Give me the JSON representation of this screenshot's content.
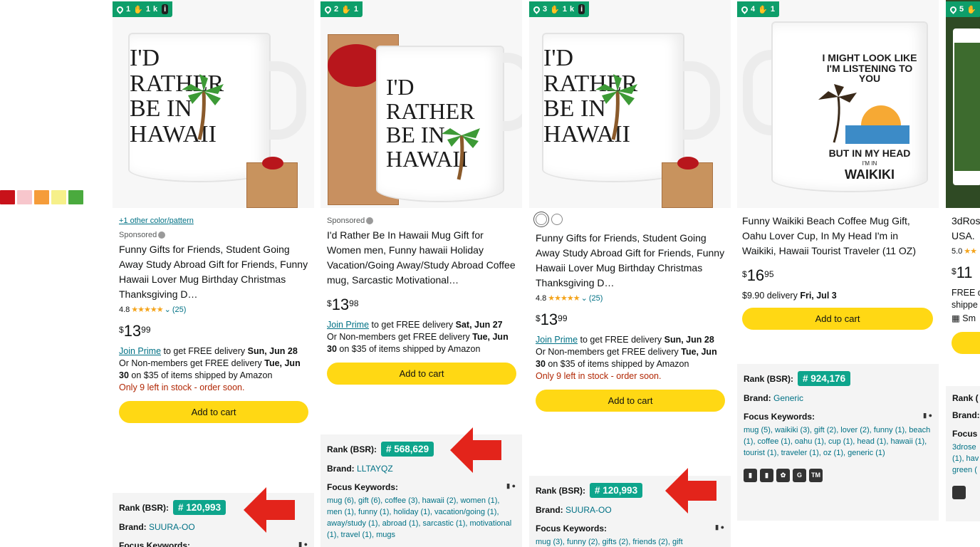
{
  "swatches": [
    "#c8121a",
    "#f7c6cc",
    "#f59c3a",
    "#f6f08a",
    "#4aaa3e"
  ],
  "cards": [
    {
      "label_num": "1",
      "label_reviews": "1",
      "label_extra": "k",
      "img_text": "I'D RATHER BE IN HAWAII",
      "other_color_link": "+1 other color/pattern",
      "sponsored": "Sponsored",
      "title": "Funny Gifts for Friends, Student Going Away Study Abroad Gift for Friends, Funny Hawaii Lover Mug Birthday Christmas Thanksgiving D…",
      "rating": "4.8",
      "stars": "★★★★★",
      "reviews": "(25)",
      "price_cur": "$",
      "price_whole": "13",
      "price_frac": "99",
      "join_prime": "Join Prime",
      "delivery_prime": " to get FREE delivery ",
      "delivery_prime_date": "Sun, Jun 28",
      "delivery_or": "Or Non-members get FREE delivery ",
      "delivery_or_date": "Tue, Jun 30",
      "delivery_or_tail": " on $35 of items shipped by Amazon",
      "stock": "Only 9 left in stock - order soon.",
      "cart": "Add to cart",
      "rank_label": "Rank (BSR):",
      "rank": "# 120,993",
      "brand_label": "Brand:",
      "brand": "SUURA-OO",
      "focus_label": "Focus Keywords:"
    },
    {
      "label_num": "2",
      "label_reviews": "1",
      "img_text": "I'D RATHER BE IN HAWAII",
      "sponsored": "Sponsored",
      "title": "I'd Rather Be In Hawaii Mug Gift for Women men, Funny hawaii Holiday Vacation/Going Away/Study Abroad Coffee mug, Sarcastic Motivational…",
      "price_cur": "$",
      "price_whole": "13",
      "price_frac": "98",
      "join_prime": "Join Prime",
      "delivery_prime": " to get FREE delivery ",
      "delivery_prime_date": "Sat, Jun 27",
      "delivery_or": "Or Non-members get FREE delivery ",
      "delivery_or_date": "Tue, Jun 30",
      "delivery_or_tail": " on $35 of items shipped by Amazon",
      "cart": "Add to cart",
      "rank_label": "Rank (BSR):",
      "rank": "# 568,629",
      "brand_label": "Brand:",
      "brand": "LLTAYQZ",
      "focus_label": "Focus Keywords:",
      "keywords": "mug (6), gift (6), coffee (3), hawaii (2), women (1), men (1), funny (1), holiday (1), vacation/going (1), away/study (1), abroad (1), sarcastic (1), motivational (1), travel (1), mugs"
    },
    {
      "label_num": "3",
      "label_reviews": "1",
      "label_extra": "k",
      "img_text": "I'D RATHER BE IN HAWAII",
      "title": "Funny Gifts for Friends, Student Going Away Study Abroad Gift for Friends, Funny Hawaii Lover Mug Birthday Christmas Thanksgiving D…",
      "rating": "4.8",
      "stars": "★★★★★",
      "reviews": "(25)",
      "price_cur": "$",
      "price_whole": "13",
      "price_frac": "99",
      "join_prime": "Join Prime",
      "delivery_prime": " to get FREE delivery ",
      "delivery_prime_date": "Sun, Jun 28",
      "delivery_or": "Or Non-members get FREE delivery ",
      "delivery_or_date": "Tue, Jun 30",
      "delivery_or_tail": " on $35 of items shipped by Amazon",
      "stock": "Only 9 left in stock - order soon.",
      "cart": "Add to cart",
      "rank_label": "Rank (BSR):",
      "rank": "# 120,993",
      "brand_label": "Brand:",
      "brand": "SUURA-OO",
      "focus_label": "Focus Keywords:",
      "keywords": "mug (3), funny (2), gifts (2), friends (2), gift"
    },
    {
      "label_num": "4",
      "label_reviews": "1",
      "img_text_top": "I MIGHT LOOK LIKE I'M LISTENING TO YOU",
      "img_text_bottom": "BUT IN MY HEAD",
      "img_text_small": "I'M IN",
      "img_text_place": "WAIKIKI",
      "title": "Funny Waikiki Beach Coffee Mug Gift, Oahu Lover Cup, In My Head I'm in Waikiki, Hawaii Tourist Traveler (11 OZ)",
      "price_cur": "$",
      "price_whole": "16",
      "price_frac": "95",
      "delivery_paid": "$9.90 delivery ",
      "delivery_paid_date": "Fri, Jul 3",
      "cart": "Add to cart",
      "rank_label": "Rank (BSR):",
      "rank": "# 924,176",
      "brand_label": "Brand:",
      "brand": "Generic",
      "focus_label": "Focus Keywords:",
      "keywords": "mug (5), waikiki (3), gift (2), lover (2), funny (1), beach (1), coffee (1), oahu (1), cup (1), head (1), hawaii (1), tourist (1), traveler (1), oz (1), generic (1)",
      "tools": [
        "▮",
        "▮",
        "✿",
        "G",
        "TM"
      ]
    },
    {
      "label_num": "5",
      "title": "3dRos USA. ",
      "rating": "5.0",
      "stars": "★★",
      "price_cur": "$",
      "price_whole": "11",
      "delivery_line1": "FREE d",
      "delivery_line2": "shippe",
      "small_business": "Sm",
      "rank_label": "Rank (",
      "brand_label": "Brand:",
      "focus_label": "Focus",
      "keywords": "3drose (1), hav green ("
    }
  ]
}
